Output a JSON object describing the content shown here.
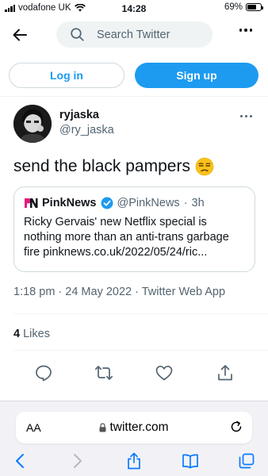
{
  "status_bar": {
    "carrier": "vodafone UK",
    "time": "14:28",
    "battery": "69%",
    "battery_level": 0.69
  },
  "nav": {
    "search_placeholder": "Search Twitter"
  },
  "auth": {
    "login_label": "Log in",
    "signup_label": "Sign up"
  },
  "tweet": {
    "display_name": "ryjaska",
    "handle": "@ry_jaska",
    "text": "send the black pampers",
    "emoji": "unamused-face-emoji",
    "quote": {
      "name": "PinkNews",
      "handle": "@PinkNews",
      "separator": "·",
      "age": "3h",
      "body": "Ricky Gervais' new Netflix special is nothing more than an anti-trans garbage fire pinknews.co.uk/2022/05/24/ric..."
    },
    "meta": "1:18 pm · 24 May 2022 · Twitter Web App",
    "likes_count": "4",
    "likes_label": "Likes"
  },
  "actions": [
    "reply-icon",
    "retweet-icon",
    "like-icon",
    "share-icon"
  ],
  "safari": {
    "text_size_label": "AA",
    "url": "twitter.com"
  },
  "colors": {
    "accent": "#1d9bf0",
    "text": "#0f1419",
    "secondary": "#536471",
    "safari_blue": "#0a7aff"
  }
}
